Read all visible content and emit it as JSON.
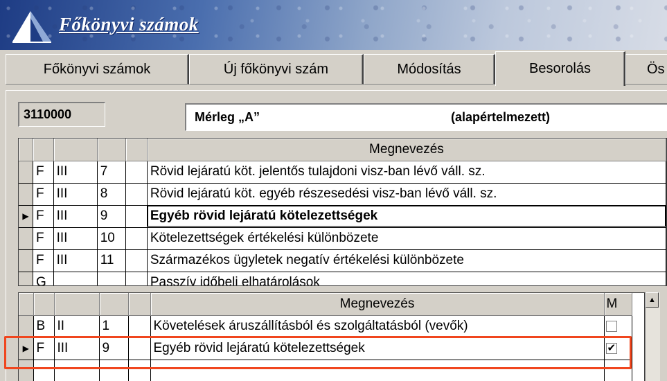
{
  "window": {
    "title": "Főkönyvi számok"
  },
  "tabs": [
    {
      "label": "Főkönyvi számok"
    },
    {
      "label": "Új főkönyvi szám"
    },
    {
      "label": "Módosítás"
    },
    {
      "label": "Besorolás"
    },
    {
      "label": "Ös"
    }
  ],
  "header": {
    "account_code": "3110000",
    "scheme_name": "Mérleg „A”",
    "scheme_note": "(alapértelmezett)"
  },
  "upper_grid": {
    "header": "Megnevezés",
    "rows": [
      {
        "c1": "F",
        "c2": "III",
        "c3": "7",
        "name": "Rövid lejáratú köt. jelentős tulajdoni visz-ban lévő váll. sz."
      },
      {
        "c1": "F",
        "c2": "III",
        "c3": "8",
        "name": "Rövid lejáratú köt. egyéb részesedési visz-ban lévő váll. sz."
      },
      {
        "c1": "F",
        "c2": "III",
        "c3": "9",
        "name": "Egyéb rövid lejáratú kötelezettségek"
      },
      {
        "c1": "F",
        "c2": "III",
        "c3": "10",
        "name": "Kötelezettségek értékelési különbözete"
      },
      {
        "c1": "F",
        "c2": "III",
        "c3": "11",
        "name": "Származékos ügyletek negatív értékelési különbözete"
      },
      {
        "c1": "G",
        "c2": "",
        "c3": "",
        "name": "Passzív időbeli elhatárolások"
      }
    ]
  },
  "lower_grid": {
    "header": "Megnevezés",
    "m_header": "M",
    "rows": [
      {
        "c1": "B",
        "c2": "II",
        "c3": "1",
        "name": "Követelések áruszállításból és szolgáltatásból (vevők)",
        "m": false
      },
      {
        "c1": "F",
        "c2": "III",
        "c3": "9",
        "name": "Egyéb rövid lejáratú kötelezettségek",
        "m": true
      }
    ]
  },
  "colors": {
    "highlight": "#f0461e",
    "banner": "#1e3c84"
  }
}
